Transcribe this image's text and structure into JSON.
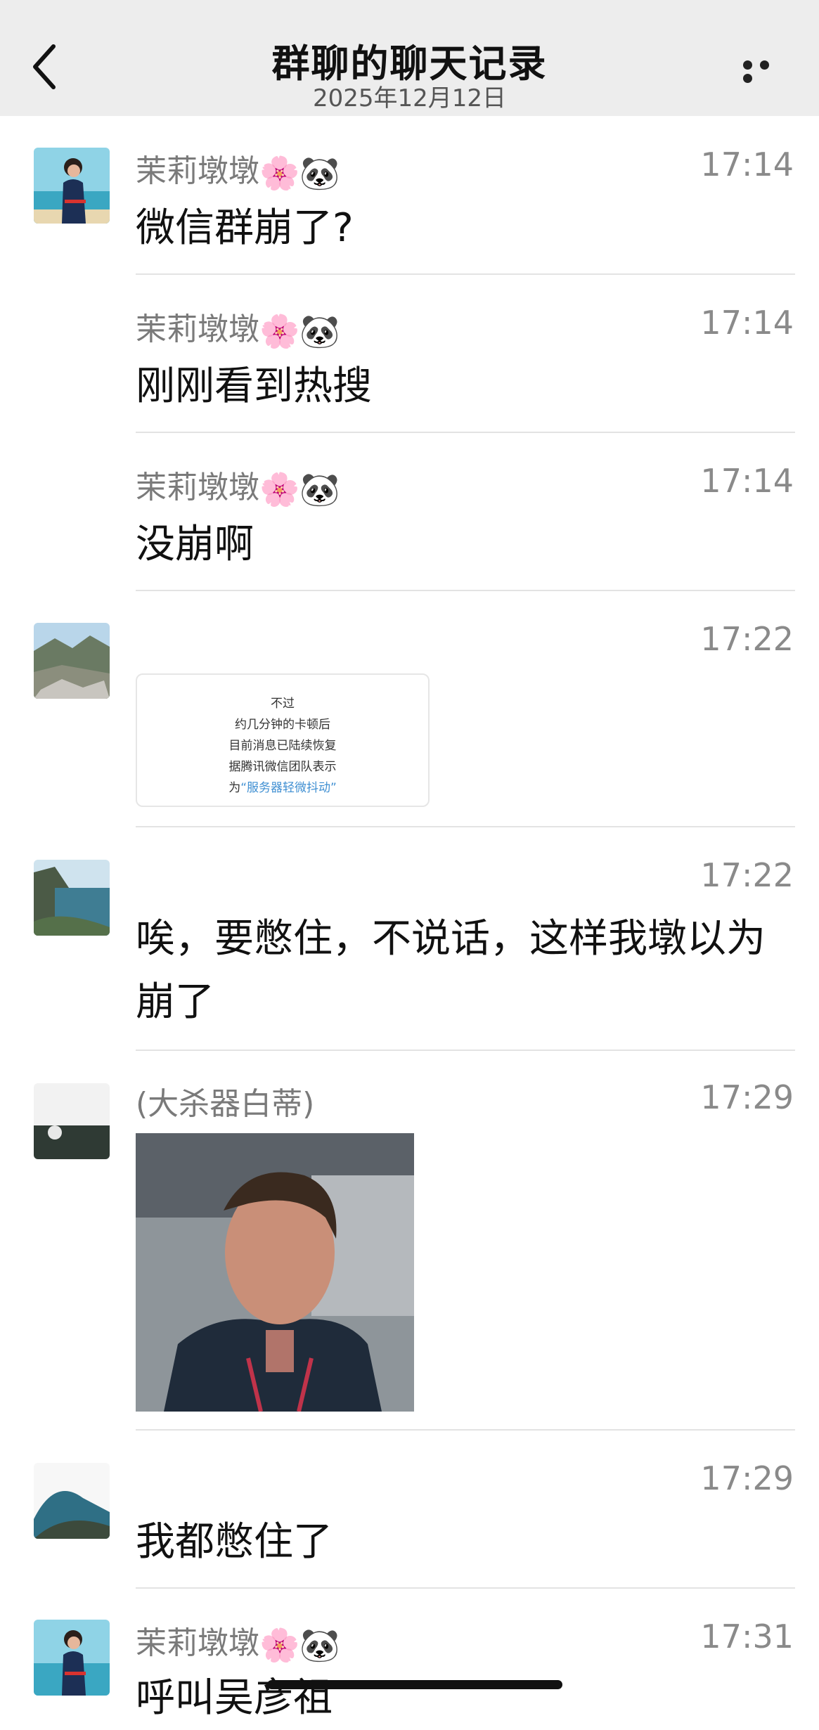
{
  "header": {
    "title": "群聊的聊天记录",
    "date": "2025年12月12日"
  },
  "messages": [
    {
      "sender": "茉莉墩墩",
      "emoji": "🌸🐼",
      "time": "17:14",
      "text": "微信群崩了?"
    },
    {
      "sender": "茉莉墩墩",
      "emoji": "🌸🐼",
      "time": "17:14",
      "text": "刚刚看到热搜"
    },
    {
      "sender": "茉莉墩墩",
      "emoji": "🌸🐼",
      "time": "17:14",
      "text": "没崩啊"
    },
    {
      "sender": "",
      "time": "17:22",
      "card_lines": [
        "不过",
        "约几分钟的卡顿后",
        "目前消息已陆续恢复",
        "据腾讯微信团队表示"
      ],
      "card_prefix": "为",
      "card_highlight": "“服务器轻微抖动”"
    },
    {
      "sender": "",
      "time": "17:22",
      "text": "唉，要憋住，不说话，这样我墩以为崩了"
    },
    {
      "sender": "(大杀器白蒂)",
      "time": "17:29"
    },
    {
      "sender": "",
      "time": "17:29",
      "text": "我都憋住了"
    },
    {
      "sender": "茉莉墩墩",
      "emoji": "🌸🐼",
      "time": "17:31",
      "text": "呼叫吴彦祖"
    }
  ]
}
